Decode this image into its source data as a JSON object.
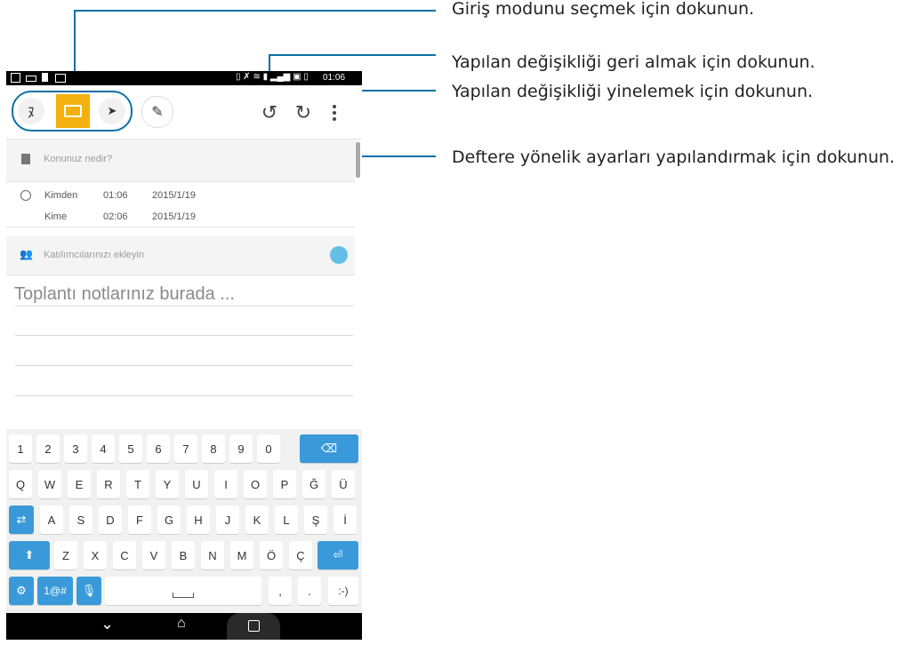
{
  "annotations": [
    "Giriş modunu seçmek için dokunun.",
    "Yapılan değişikliği geri almak için dokunun.",
    "Yapılan değişikliği yinelemek için dokunun.",
    "Deftere yönelik ayarları yapılandırmak için dokunun."
  ],
  "status": {
    "time": "01:06"
  },
  "form": {
    "topic_placeholder": "Konunuz nedir?",
    "from_label": "Kimden",
    "from_time": "01:06",
    "from_date": "2015/1/19",
    "to_label": "Kime",
    "to_time": "02:06",
    "to_date": "2015/1/19",
    "participants_placeholder": "Katılımcılarınızı ekleyin",
    "notes_placeholder": "Toplantı notlarınız burada ..."
  },
  "keyboard": {
    "row1": [
      "1",
      "2",
      "3",
      "4",
      "5",
      "6",
      "7",
      "8",
      "9",
      "0"
    ],
    "row2": [
      "Q",
      "W",
      "E",
      "R",
      "T",
      "Y",
      "U",
      "I",
      "O",
      "P",
      "Ğ",
      "Ü"
    ],
    "row3": [
      "A",
      "S",
      "D",
      "F",
      "G",
      "H",
      "J",
      "K",
      "L",
      "Ş",
      "İ"
    ],
    "row4": [
      "Z",
      "X",
      "C",
      "V",
      "B",
      "N",
      "M",
      "Ö",
      "Ç"
    ],
    "mode_key": "1@#",
    "comma": ",",
    "period": ".",
    "smiley": ":-)"
  },
  "colors": {
    "accent": "#f2b10e",
    "keyboard_blue": "#3a9ad9",
    "callout_line": "#0b6fa7"
  }
}
